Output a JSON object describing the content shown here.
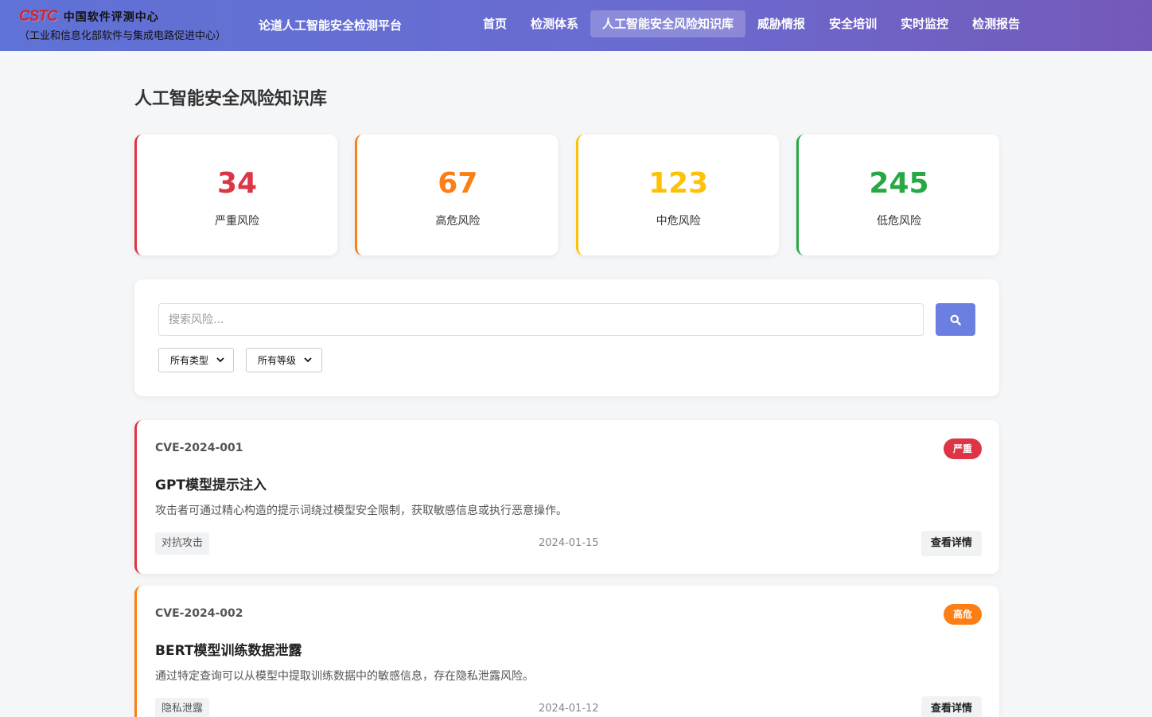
{
  "header": {
    "logo_mark": "CSTC",
    "logo_name": "中国软件评测中心",
    "logo_sub": "（工业和信息化部软件与集成电路促进中心）",
    "platform_title": "论道人工智能安全检测平台",
    "nav": [
      {
        "label": "首页",
        "active": false
      },
      {
        "label": "检测体系",
        "active": false
      },
      {
        "label": "人工智能安全风险知识库",
        "active": true
      },
      {
        "label": "威胁情报",
        "active": false
      },
      {
        "label": "安全培训",
        "active": false
      },
      {
        "label": "实时监控",
        "active": false
      },
      {
        "label": "检测报告",
        "active": false
      }
    ]
  },
  "page_title": "人工智能安全风险知识库",
  "stats": [
    {
      "value": "34",
      "label": "严重风险",
      "color": "#dc3545"
    },
    {
      "value": "67",
      "label": "高危风险",
      "color": "#fd7e14"
    },
    {
      "value": "123",
      "label": "中危风险",
      "color": "#ffc107"
    },
    {
      "value": "245",
      "label": "低危风险",
      "color": "#28a745"
    }
  ],
  "search": {
    "placeholder": "搜索风险...",
    "button_icon": "search-icon",
    "type_filter": "所有类型",
    "level_filter": "所有等级"
  },
  "risks": [
    {
      "id": "CVE-2024-001",
      "badge": "严重",
      "color": "#dc3545",
      "title": "GPT模型提示注入",
      "description": "攻击者可通过精心构造的提示词绕过模型安全限制，获取敏感信息或执行恶意操作。",
      "tag": "对抗攻击",
      "date": "2024-01-15",
      "detail_label": "查看详情"
    },
    {
      "id": "CVE-2024-002",
      "badge": "高危",
      "color": "#fd7e14",
      "title": "BERT模型训练数据泄露",
      "description": "通过特定查询可以从模型中提取训练数据中的敏感信息，存在隐私泄露风险。",
      "tag": "隐私泄露",
      "date": "2024-01-12",
      "detail_label": "查看详情"
    }
  ]
}
